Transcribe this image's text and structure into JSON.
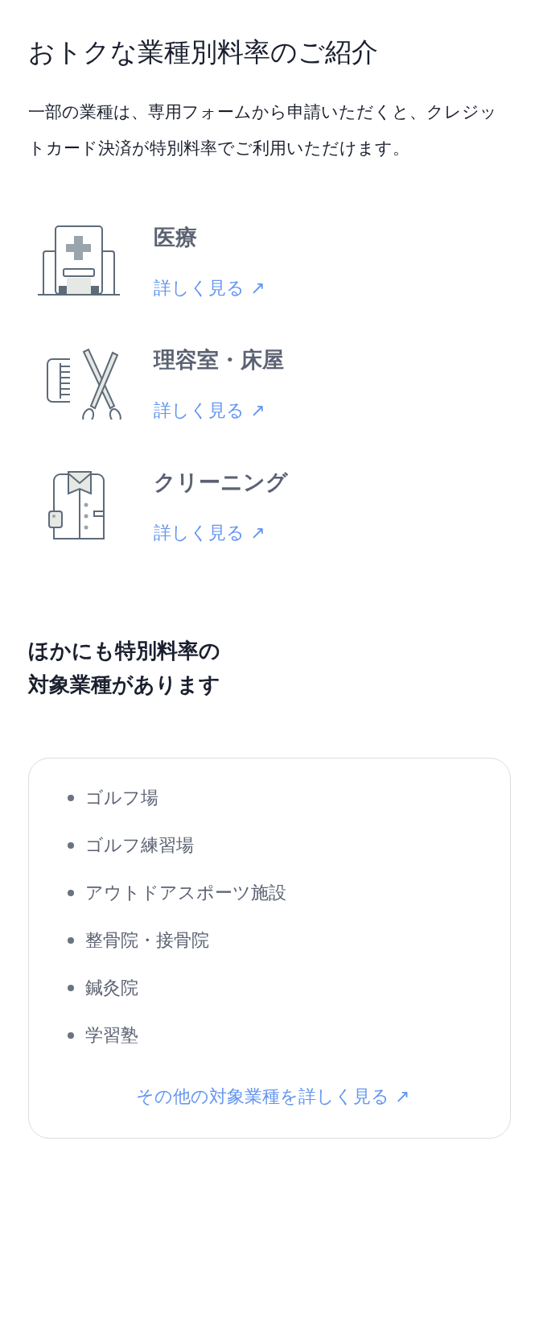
{
  "title": "おトクな業種別料率のご紹介",
  "intro": "一部の業種は、専用フォームから申請いただくと、クレジットカード決済が特別料率でご利用いただけます。",
  "industries": [
    {
      "kind": "hospital",
      "name": "医療",
      "link": "詳しく見る ↗"
    },
    {
      "kind": "barber",
      "name": "理容室・床屋",
      "link": "詳しく見る ↗"
    },
    {
      "kind": "cleaning",
      "name": "クリーニング",
      "link": "詳しく見る ↗"
    }
  ],
  "others": {
    "heading_lines": [
      "ほかにも特別料率の",
      "対象業種があります"
    ],
    "items": [
      "ゴルフ場",
      "ゴルフ練習場",
      "アウトドアスポーツ施設",
      "整骨院・接骨院",
      "鍼灸院",
      "学習塾"
    ],
    "link": "その他の対象業種を詳しく見る ↗"
  }
}
